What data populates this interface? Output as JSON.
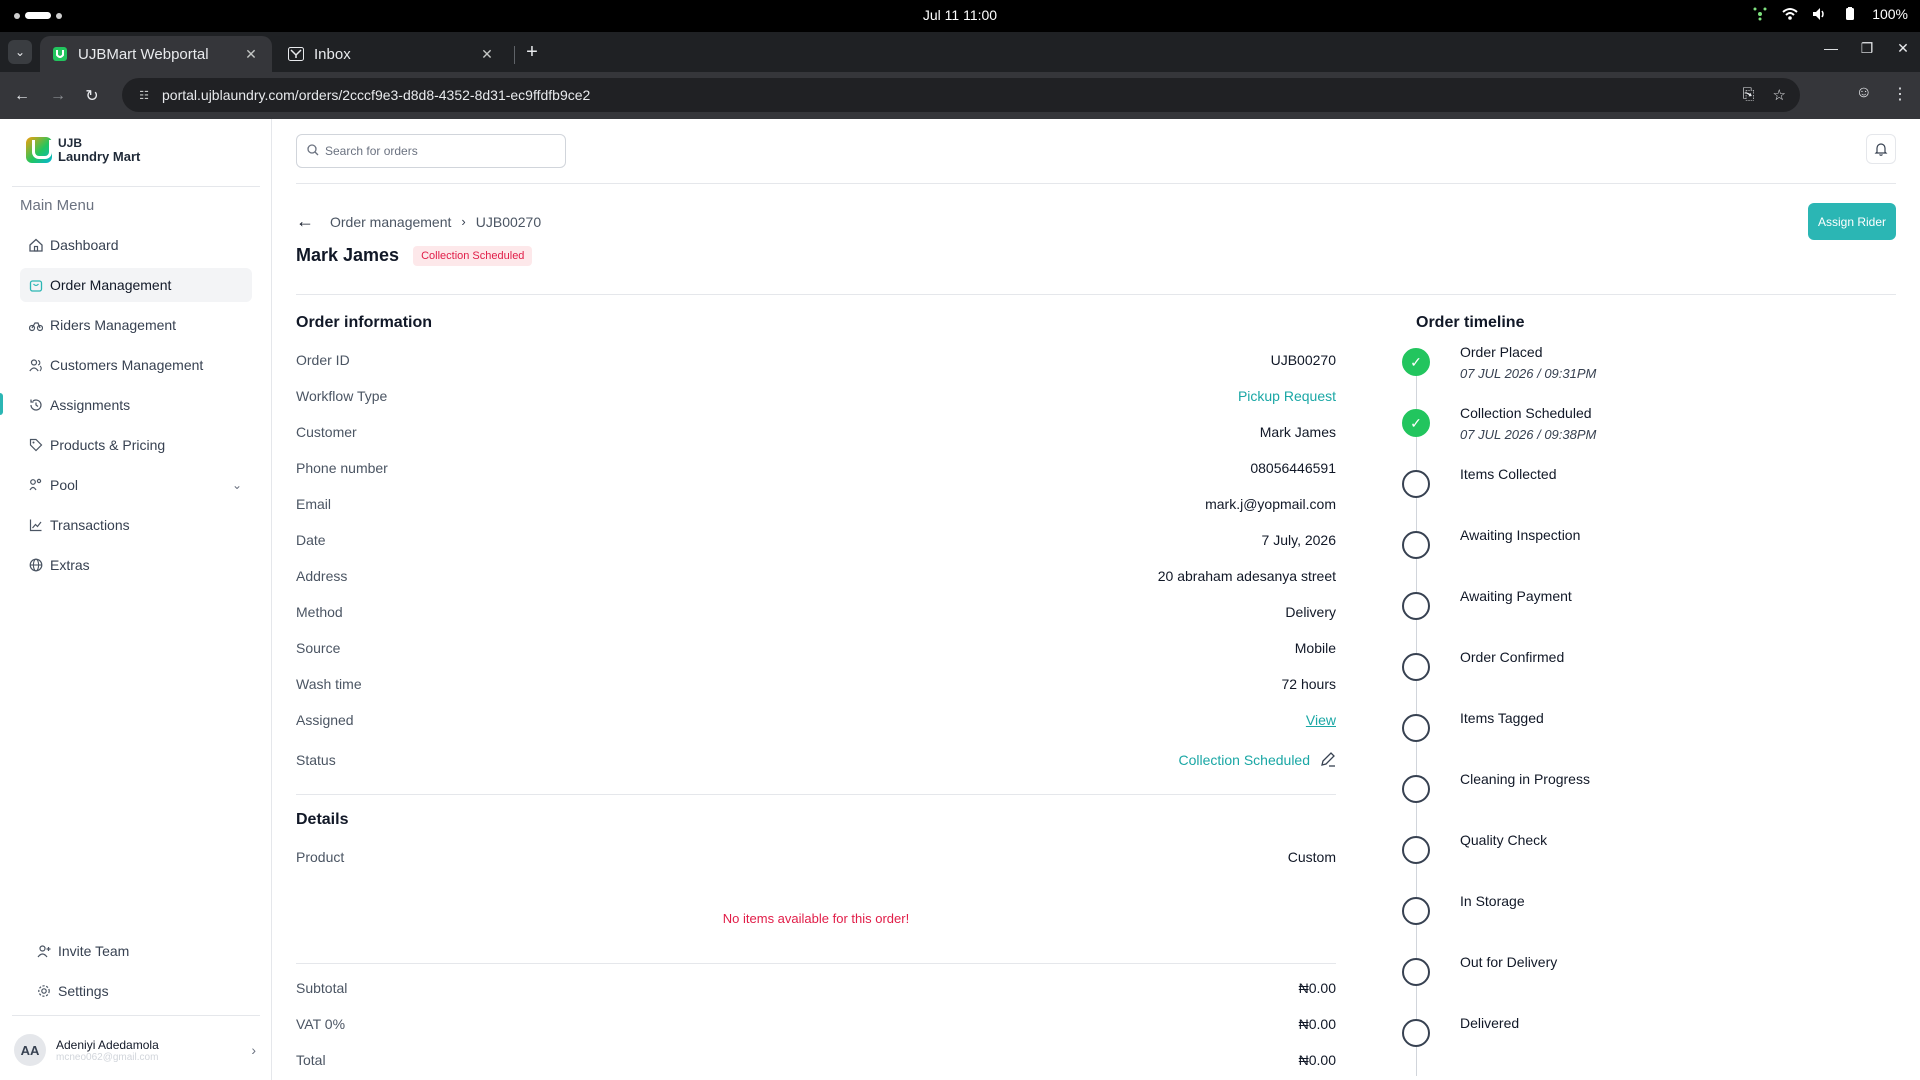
{
  "os": {
    "clock": "Jul 11  11:00",
    "battery": "100%"
  },
  "browser": {
    "tabs": [
      {
        "title": "UJBMart Webportal",
        "active": true
      },
      {
        "title": "Inbox",
        "active": false
      }
    ],
    "url": "portal.ujblaundry.com/orders/2cccf9e3-d8d8-4352-8d31-ec9ffdfb9ce2"
  },
  "sidebar": {
    "logo_line1": "UJB",
    "logo_line2": "Laundry Mart",
    "section": "Main Menu",
    "items": [
      {
        "label": "Dashboard",
        "icon": "home-icon"
      },
      {
        "label": "Order Management",
        "icon": "shopping-bag-icon",
        "active": true
      },
      {
        "label": "Riders Management",
        "icon": "bike-icon"
      },
      {
        "label": "Customers Management",
        "icon": "users-icon"
      },
      {
        "label": "Assignments",
        "icon": "history-icon"
      },
      {
        "label": "Products & Pricing",
        "icon": "tag-icon"
      },
      {
        "label": "Pool",
        "icon": "pool-icon"
      },
      {
        "label": "Transactions",
        "icon": "chart-line-icon"
      },
      {
        "label": "Extras",
        "icon": "globe-icon"
      }
    ],
    "bottom": [
      {
        "label": "Invite Team",
        "icon": "user-plus-icon"
      },
      {
        "label": "Settings",
        "icon": "gear-icon"
      }
    ],
    "user": {
      "initials": "AA",
      "name": "Adeniyi Adedamola",
      "email": "mcneo062@gmail.com"
    }
  },
  "header": {
    "search_placeholder": "Search for orders",
    "breadcrumb_parent": "Order management",
    "breadcrumb_current": "UJB00270",
    "title": "Mark James",
    "status_badge": "Collection Scheduled",
    "assign_button": "Assign Rider"
  },
  "order_info": {
    "title": "Order information",
    "rows": [
      {
        "label": "Order ID",
        "value": "UJB00270"
      },
      {
        "label": "Workflow Type",
        "value": "Pickup Request"
      },
      {
        "label": "Customer",
        "value": "Mark James"
      },
      {
        "label": "Phone number",
        "value": "08056446591"
      },
      {
        "label": "Email",
        "value": "mark.j@yopmail.com"
      },
      {
        "label": "Date",
        "value": "7 July, 2026"
      },
      {
        "label": "Address",
        "value": "20 abraham adesanya street"
      },
      {
        "label": "Method",
        "value": "Delivery"
      },
      {
        "label": "Source",
        "value": "Mobile"
      },
      {
        "label": "Wash time",
        "value": "72 hours"
      },
      {
        "label": "Assigned",
        "value": "View"
      }
    ],
    "status_label": "Status",
    "status_value": "Collection Scheduled"
  },
  "details": {
    "title": "Details",
    "product_label": "Product",
    "product_value": "Custom",
    "empty_message": "No items available for this order!",
    "totals": [
      {
        "label": "Subtotal",
        "value": "₦0.00"
      },
      {
        "label": "VAT 0%",
        "value": "₦0.00"
      },
      {
        "label": "Total",
        "value": "₦0.00"
      }
    ]
  },
  "timeline": {
    "title": "Order timeline",
    "steps": [
      {
        "label": "Order Placed",
        "date": "07 JUL 2026 / 09:31PM",
        "done": true
      },
      {
        "label": "Collection Scheduled",
        "date": "07 JUL 2026 / 09:38PM",
        "done": true
      },
      {
        "label": "Items Collected",
        "date": "",
        "done": false
      },
      {
        "label": "Awaiting Inspection",
        "date": "",
        "done": false
      },
      {
        "label": "Awaiting Payment",
        "date": "",
        "done": false
      },
      {
        "label": "Order Confirmed",
        "date": "",
        "done": false
      },
      {
        "label": "Items Tagged",
        "date": "",
        "done": false
      },
      {
        "label": "Cleaning in Progress",
        "date": "",
        "done": false
      },
      {
        "label": "Quality Check",
        "date": "",
        "done": false
      },
      {
        "label": "In Storage",
        "date": "",
        "done": false
      },
      {
        "label": "Out for Delivery",
        "date": "",
        "done": false
      },
      {
        "label": "Delivered",
        "date": "",
        "done": false
      }
    ]
  },
  "colors": {
    "accent": "#2bb6b4",
    "danger": "#e11d48",
    "success": "#22c55e"
  }
}
